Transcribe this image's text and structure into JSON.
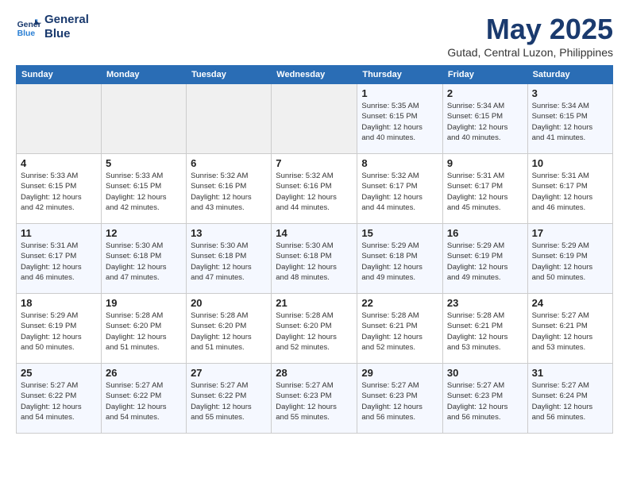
{
  "header": {
    "logo_line1": "General",
    "logo_line2": "Blue",
    "month": "May 2025",
    "location": "Gutad, Central Luzon, Philippines"
  },
  "days_of_week": [
    "Sunday",
    "Monday",
    "Tuesday",
    "Wednesday",
    "Thursday",
    "Friday",
    "Saturday"
  ],
  "weeks": [
    [
      {
        "day": "",
        "info": ""
      },
      {
        "day": "",
        "info": ""
      },
      {
        "day": "",
        "info": ""
      },
      {
        "day": "",
        "info": ""
      },
      {
        "day": "1",
        "info": "Sunrise: 5:35 AM\nSunset: 6:15 PM\nDaylight: 12 hours\nand 40 minutes."
      },
      {
        "day": "2",
        "info": "Sunrise: 5:34 AM\nSunset: 6:15 PM\nDaylight: 12 hours\nand 40 minutes."
      },
      {
        "day": "3",
        "info": "Sunrise: 5:34 AM\nSunset: 6:15 PM\nDaylight: 12 hours\nand 41 minutes."
      }
    ],
    [
      {
        "day": "4",
        "info": "Sunrise: 5:33 AM\nSunset: 6:15 PM\nDaylight: 12 hours\nand 42 minutes."
      },
      {
        "day": "5",
        "info": "Sunrise: 5:33 AM\nSunset: 6:15 PM\nDaylight: 12 hours\nand 42 minutes."
      },
      {
        "day": "6",
        "info": "Sunrise: 5:32 AM\nSunset: 6:16 PM\nDaylight: 12 hours\nand 43 minutes."
      },
      {
        "day": "7",
        "info": "Sunrise: 5:32 AM\nSunset: 6:16 PM\nDaylight: 12 hours\nand 44 minutes."
      },
      {
        "day": "8",
        "info": "Sunrise: 5:32 AM\nSunset: 6:17 PM\nDaylight: 12 hours\nand 44 minutes."
      },
      {
        "day": "9",
        "info": "Sunrise: 5:31 AM\nSunset: 6:17 PM\nDaylight: 12 hours\nand 45 minutes."
      },
      {
        "day": "10",
        "info": "Sunrise: 5:31 AM\nSunset: 6:17 PM\nDaylight: 12 hours\nand 46 minutes."
      }
    ],
    [
      {
        "day": "11",
        "info": "Sunrise: 5:31 AM\nSunset: 6:17 PM\nDaylight: 12 hours\nand 46 minutes."
      },
      {
        "day": "12",
        "info": "Sunrise: 5:30 AM\nSunset: 6:18 PM\nDaylight: 12 hours\nand 47 minutes."
      },
      {
        "day": "13",
        "info": "Sunrise: 5:30 AM\nSunset: 6:18 PM\nDaylight: 12 hours\nand 47 minutes."
      },
      {
        "day": "14",
        "info": "Sunrise: 5:30 AM\nSunset: 6:18 PM\nDaylight: 12 hours\nand 48 minutes."
      },
      {
        "day": "15",
        "info": "Sunrise: 5:29 AM\nSunset: 6:18 PM\nDaylight: 12 hours\nand 49 minutes."
      },
      {
        "day": "16",
        "info": "Sunrise: 5:29 AM\nSunset: 6:19 PM\nDaylight: 12 hours\nand 49 minutes."
      },
      {
        "day": "17",
        "info": "Sunrise: 5:29 AM\nSunset: 6:19 PM\nDaylight: 12 hours\nand 50 minutes."
      }
    ],
    [
      {
        "day": "18",
        "info": "Sunrise: 5:29 AM\nSunset: 6:19 PM\nDaylight: 12 hours\nand 50 minutes."
      },
      {
        "day": "19",
        "info": "Sunrise: 5:28 AM\nSunset: 6:20 PM\nDaylight: 12 hours\nand 51 minutes."
      },
      {
        "day": "20",
        "info": "Sunrise: 5:28 AM\nSunset: 6:20 PM\nDaylight: 12 hours\nand 51 minutes."
      },
      {
        "day": "21",
        "info": "Sunrise: 5:28 AM\nSunset: 6:20 PM\nDaylight: 12 hours\nand 52 minutes."
      },
      {
        "day": "22",
        "info": "Sunrise: 5:28 AM\nSunset: 6:21 PM\nDaylight: 12 hours\nand 52 minutes."
      },
      {
        "day": "23",
        "info": "Sunrise: 5:28 AM\nSunset: 6:21 PM\nDaylight: 12 hours\nand 53 minutes."
      },
      {
        "day": "24",
        "info": "Sunrise: 5:27 AM\nSunset: 6:21 PM\nDaylight: 12 hours\nand 53 minutes."
      }
    ],
    [
      {
        "day": "25",
        "info": "Sunrise: 5:27 AM\nSunset: 6:22 PM\nDaylight: 12 hours\nand 54 minutes."
      },
      {
        "day": "26",
        "info": "Sunrise: 5:27 AM\nSunset: 6:22 PM\nDaylight: 12 hours\nand 54 minutes."
      },
      {
        "day": "27",
        "info": "Sunrise: 5:27 AM\nSunset: 6:22 PM\nDaylight: 12 hours\nand 55 minutes."
      },
      {
        "day": "28",
        "info": "Sunrise: 5:27 AM\nSunset: 6:23 PM\nDaylight: 12 hours\nand 55 minutes."
      },
      {
        "day": "29",
        "info": "Sunrise: 5:27 AM\nSunset: 6:23 PM\nDaylight: 12 hours\nand 56 minutes."
      },
      {
        "day": "30",
        "info": "Sunrise: 5:27 AM\nSunset: 6:23 PM\nDaylight: 12 hours\nand 56 minutes."
      },
      {
        "day": "31",
        "info": "Sunrise: 5:27 AM\nSunset: 6:24 PM\nDaylight: 12 hours\nand 56 minutes."
      }
    ]
  ]
}
